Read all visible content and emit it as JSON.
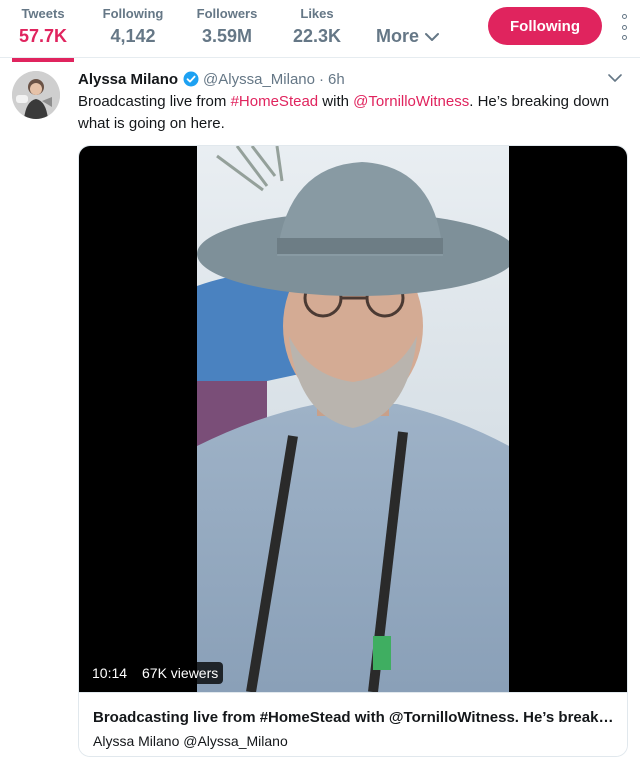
{
  "nav": {
    "tweets": {
      "label": "Tweets",
      "value": "57.7K"
    },
    "following": {
      "label": "Following",
      "value": "4,142"
    },
    "followers": {
      "label": "Followers",
      "value": "3.59M"
    },
    "likes": {
      "label": "Likes",
      "value": "22.3K"
    },
    "more_label": "More",
    "follow_button": "Following",
    "active_tab": "tweets"
  },
  "tweet": {
    "author_name": "Alyssa Milano",
    "handle": "@Alyssa_Milano",
    "separator": "·",
    "time": "6h",
    "verified": true,
    "text": {
      "part1": "Broadcasting live from ",
      "hashtag": "#HomeStead",
      "part2": " with ",
      "mention": "@TornilloWitness",
      "part3": ". He’s breaking down what is going on here."
    }
  },
  "media": {
    "duration": "10:14",
    "viewers": "67K viewers",
    "title": "Broadcasting live from #HomeStead with @TornilloWitness. He’s breaking down what is going on here.",
    "byline": "Alyssa Milano @Alyssa_Milano"
  },
  "colors": {
    "accent": "#e0245e",
    "muted": "#657786",
    "verified": "#1da1f2",
    "border": "#e6ecf0"
  },
  "icons": [
    "chevron-down-icon",
    "more-dots-icon",
    "verified-badge-icon"
  ]
}
